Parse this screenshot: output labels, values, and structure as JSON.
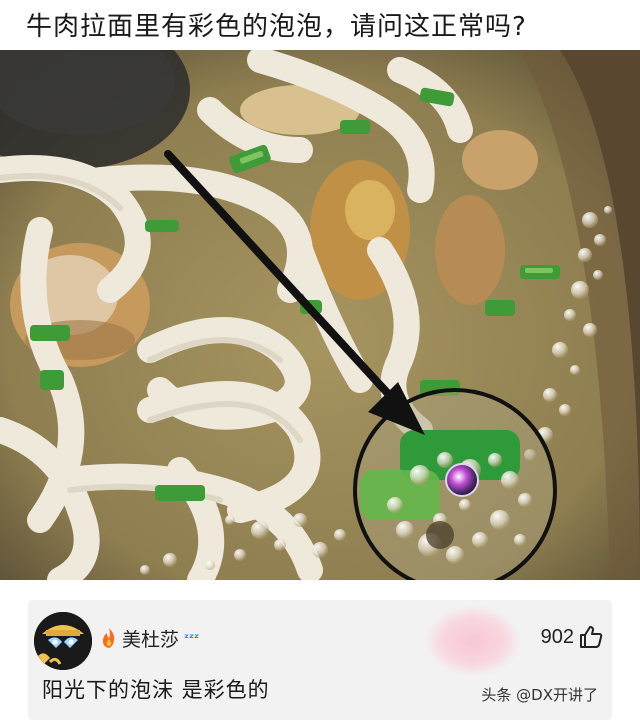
{
  "question": {
    "title": "牛肉拉面里有彩色的泡泡，请问这正常吗?"
  },
  "photo": {
    "subject": "beef-noodle-soup-with-iridescent-bubbles",
    "annotations": [
      "black-arrow",
      "circle-highlight"
    ],
    "colors": {
      "broth": "#9a8a5e",
      "noodle": "#efe9dc",
      "scallion": "#3e9b38",
      "annotation": "#111111"
    }
  },
  "comment": {
    "username": "美杜莎",
    "like_count": "902",
    "text": "阳光下的泡沫 是彩色的",
    "badge_icon": "flame-icon",
    "status_icon": "zzz-icon",
    "like_icon": "thumb-up-icon"
  },
  "watermark": {
    "text": "头条 @DX开讲了"
  }
}
